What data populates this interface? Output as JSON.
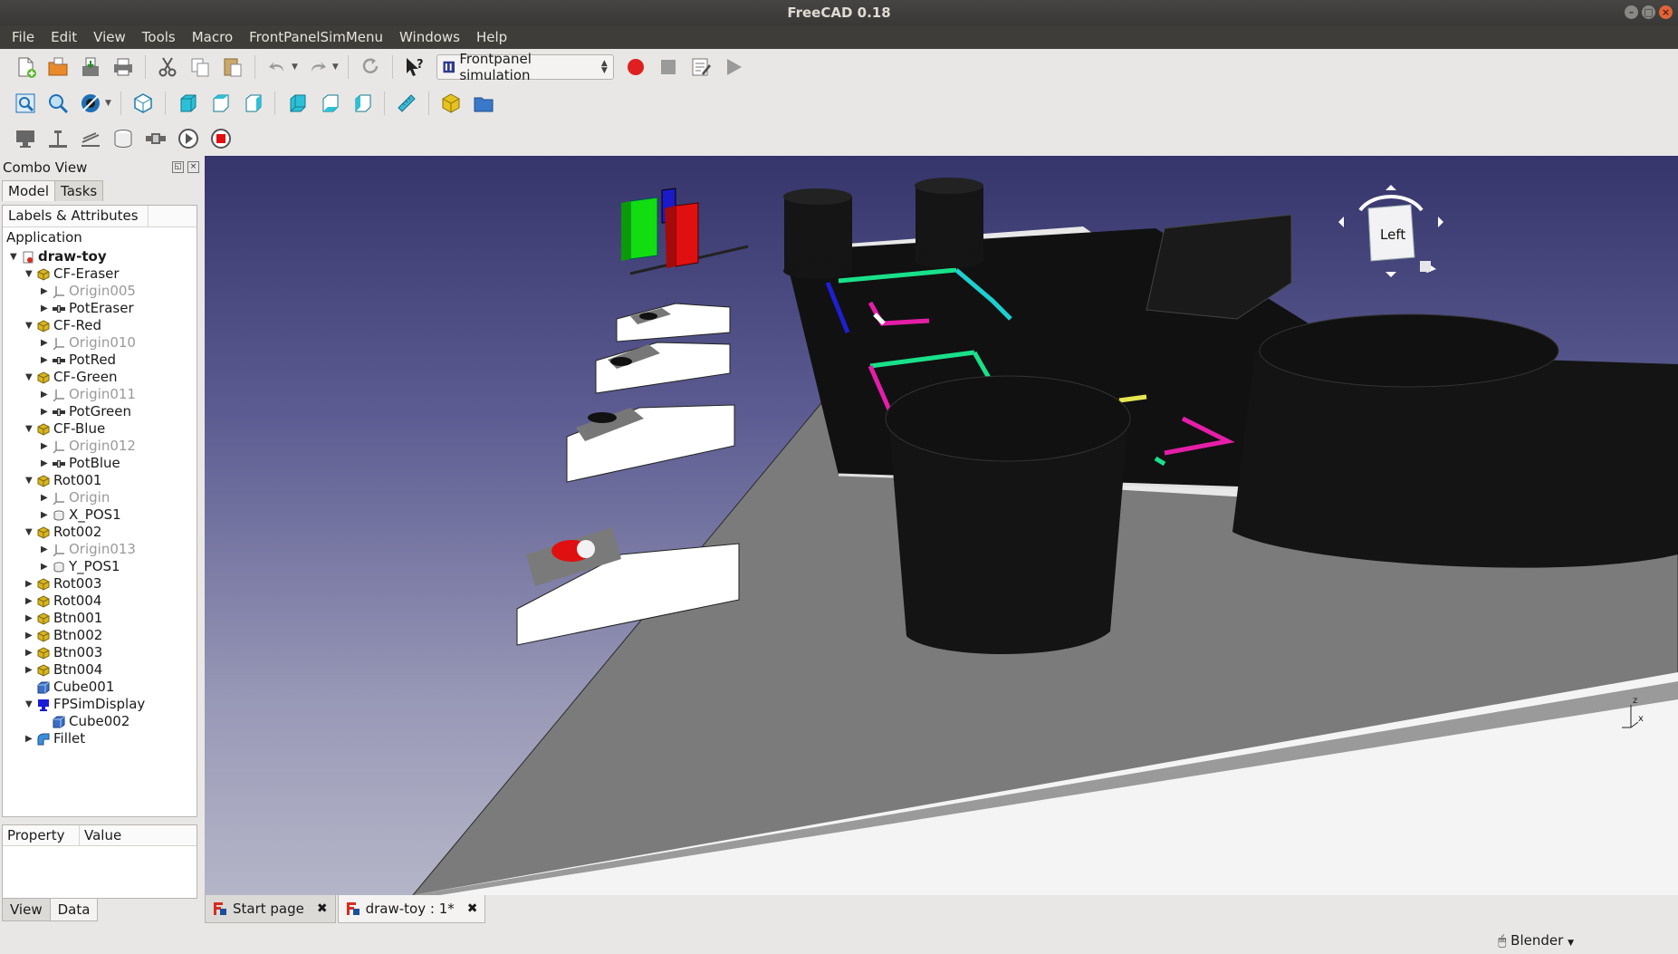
{
  "window": {
    "title": "FreeCAD 0.18"
  },
  "menu": [
    "File",
    "Edit",
    "View",
    "Tools",
    "Macro",
    "FrontPanelSimMenu",
    "Windows",
    "Help"
  ],
  "toolbar": {
    "workbench": "Frontpanel simulation",
    "icons_row1": [
      "new-file-icon",
      "open-file-icon",
      "save-icon",
      "print-icon",
      "cut-icon",
      "copy-icon",
      "paste-icon",
      "undo-icon",
      "redo-icon",
      "refresh-icon",
      "whats-this-icon",
      "record-macro-icon",
      "stop-macro-icon",
      "edit-macro-icon",
      "run-macro-icon"
    ],
    "icons_row2": [
      "fit-all-icon",
      "fit-selection-icon",
      "draw-style-icon",
      "isometric-view-icon",
      "front-view-icon",
      "top-view-icon",
      "right-view-icon",
      "rear-view-icon",
      "bottom-view-icon",
      "left-view-icon",
      "measure-icon",
      "part-icon",
      "group-icon"
    ],
    "icons_row3": [
      "display-icon",
      "slider-icon",
      "rotation-icon",
      "cylinder-icon",
      "button-icon",
      "play-icon",
      "stop-icon"
    ]
  },
  "combo": {
    "title": "Combo View",
    "tabs": [
      "Model",
      "Tasks"
    ],
    "tree_header": "Labels & Attributes",
    "application_label": "Application",
    "tree": [
      {
        "label": "draw-toy",
        "level": 0,
        "expanded": true,
        "bold": true,
        "icon": "document-icon"
      },
      {
        "label": "CF-Eraser",
        "level": 1,
        "expanded": true,
        "icon": "part-icon"
      },
      {
        "label": "Origin005",
        "level": 2,
        "dim": true,
        "icon": "origin-icon"
      },
      {
        "label": "PotEraser",
        "level": 2,
        "icon": "slider-icon"
      },
      {
        "label": "CF-Red",
        "level": 1,
        "expanded": true,
        "icon": "part-icon"
      },
      {
        "label": "Origin010",
        "level": 2,
        "dim": true,
        "icon": "origin-icon"
      },
      {
        "label": "PotRed",
        "level": 2,
        "icon": "slider-icon"
      },
      {
        "label": "CF-Green",
        "level": 1,
        "expanded": true,
        "icon": "part-icon"
      },
      {
        "label": "Origin011",
        "level": 2,
        "dim": true,
        "icon": "origin-icon"
      },
      {
        "label": "PotGreen",
        "level": 2,
        "icon": "slider-icon"
      },
      {
        "label": "CF-Blue",
        "level": 1,
        "expanded": true,
        "icon": "part-icon"
      },
      {
        "label": "Origin012",
        "level": 2,
        "dim": true,
        "icon": "origin-icon"
      },
      {
        "label": "PotBlue",
        "level": 2,
        "icon": "slider-icon"
      },
      {
        "label": "Rot001",
        "level": 1,
        "expanded": true,
        "icon": "part-icon"
      },
      {
        "label": "Origin",
        "level": 2,
        "dim": true,
        "icon": "origin-icon"
      },
      {
        "label": "X_POS1",
        "level": 2,
        "icon": "cylinder-icon"
      },
      {
        "label": "Rot002",
        "level": 1,
        "expanded": true,
        "icon": "part-icon"
      },
      {
        "label": "Origin013",
        "level": 2,
        "dim": true,
        "icon": "origin-icon"
      },
      {
        "label": "Y_POS1",
        "level": 2,
        "icon": "cylinder-icon"
      },
      {
        "label": "Rot003",
        "level": 1,
        "expanded": false,
        "icon": "part-icon"
      },
      {
        "label": "Rot004",
        "level": 1,
        "expanded": false,
        "icon": "part-icon"
      },
      {
        "label": "Btn001",
        "level": 1,
        "expanded": false,
        "icon": "part-icon"
      },
      {
        "label": "Btn002",
        "level": 1,
        "expanded": false,
        "icon": "part-icon"
      },
      {
        "label": "Btn003",
        "level": 1,
        "expanded": false,
        "icon": "part-icon"
      },
      {
        "label": "Btn004",
        "level": 1,
        "expanded": false,
        "icon": "part-icon"
      },
      {
        "label": "Cube001",
        "level": 1,
        "noarrow": true,
        "icon": "cube-icon"
      },
      {
        "label": "FPSimDisplay",
        "level": 1,
        "expanded": true,
        "icon": "display-icon"
      },
      {
        "label": "Cube002",
        "level": 2,
        "noarrow": true,
        "icon": "cube-icon"
      },
      {
        "label": "Fillet",
        "level": 1,
        "expanded": false,
        "icon": "fillet-icon"
      }
    ],
    "property_header": [
      "Property",
      "Value"
    ],
    "bottom_tabs": [
      "View",
      "Data"
    ]
  },
  "navcube": {
    "face": "Left"
  },
  "axis": {
    "z": "z",
    "x": "x"
  },
  "doc_tabs": [
    {
      "label": "Start page",
      "active": false
    },
    {
      "label": "draw-toy : 1*",
      "active": true
    }
  ],
  "status": {
    "nav_style": "Blender"
  },
  "colors": {
    "menubar": "#3e3d39",
    "titlebar": "#3b3a37",
    "part_icon": "#d9b521",
    "sketch_magenta": "#e51ea8",
    "sketch_green": "#19e08a",
    "sketch_cyan": "#1ecfcf",
    "sketch_blue": "#1f1fd2"
  }
}
